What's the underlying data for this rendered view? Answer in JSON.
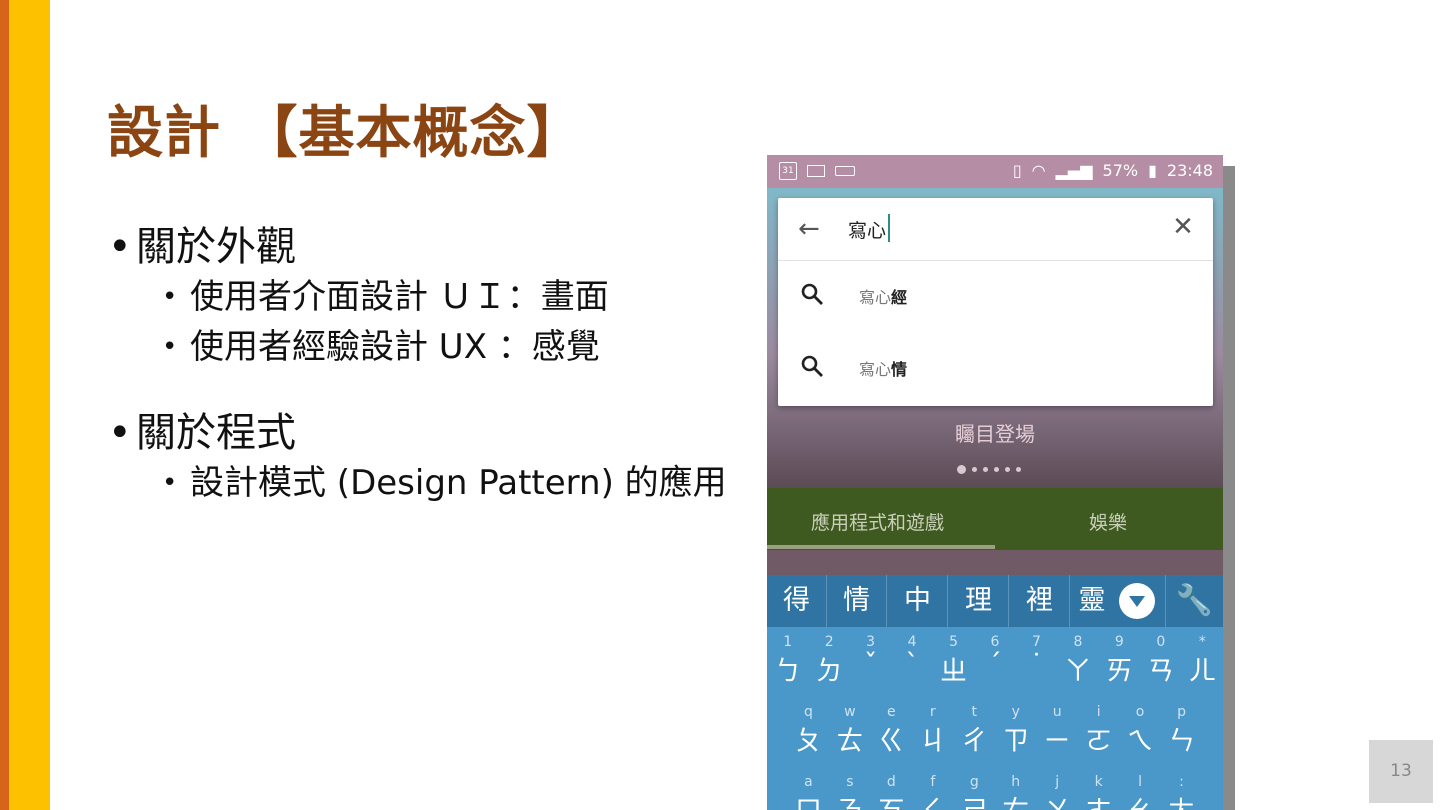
{
  "slide": {
    "title": "設計 【基本概念】",
    "bullets": [
      {
        "text": "關於外觀",
        "sub": [
          "使用者介面設計 ＵＩ：畫面",
          "使用者經驗設計 UX ：感覺"
        ]
      },
      {
        "text": "關於程式",
        "sub": [
          "設計模式 (Design Pattern) 的應用"
        ]
      }
    ],
    "page_number": "13"
  },
  "phone": {
    "status": {
      "calendar_day": "31",
      "battery": "57%",
      "time": "23:48"
    },
    "search": {
      "query": "寫心",
      "placeholder": ""
    },
    "suggestions": [
      {
        "prefix": "寫心",
        "rest": "經"
      },
      {
        "prefix": "寫心",
        "rest": "情"
      }
    ],
    "banner_text": "矚目登場",
    "tabs": [
      "應用程式和遊戲",
      "娛樂"
    ],
    "candidates": [
      "得",
      "情",
      "中",
      "理",
      "裡",
      "靈"
    ],
    "keyboard": {
      "row1": [
        [
          "1",
          "ㄅ"
        ],
        [
          "2",
          "ㄉ"
        ],
        [
          "3",
          "ˇ"
        ],
        [
          "4",
          "ˋ"
        ],
        [
          "5",
          "ㄓ"
        ],
        [
          "6",
          "ˊ"
        ],
        [
          "7",
          "˙"
        ],
        [
          "8",
          "ㄚ"
        ],
        [
          "9",
          "ㄞ"
        ],
        [
          "0",
          "ㄢ"
        ],
        [
          "*",
          "ㄦ"
        ]
      ],
      "row2": [
        [
          "q",
          "ㄆ"
        ],
        [
          "w",
          "ㄊ"
        ],
        [
          "e",
          "ㄍ"
        ],
        [
          "r",
          "ㄐ"
        ],
        [
          "t",
          "ㄔ"
        ],
        [
          "y",
          "ㄗ"
        ],
        [
          "u",
          "ㄧ"
        ],
        [
          "i",
          "ㄛ"
        ],
        [
          "o",
          "ㄟ"
        ],
        [
          "p",
          "ㄣ"
        ]
      ],
      "row3": [
        [
          "a",
          "ㄇ"
        ],
        [
          "s",
          "ㄋ"
        ],
        [
          "d",
          "ㄎ"
        ],
        [
          "f",
          "ㄑ"
        ],
        [
          "g",
          "ㄕ"
        ],
        [
          "h",
          "ㄘ"
        ],
        [
          "j",
          "ㄨ"
        ],
        [
          "k",
          "ㄜ"
        ],
        [
          "l",
          "ㄠ"
        ],
        [
          ":",
          "ㄤ"
        ]
      ]
    }
  }
}
